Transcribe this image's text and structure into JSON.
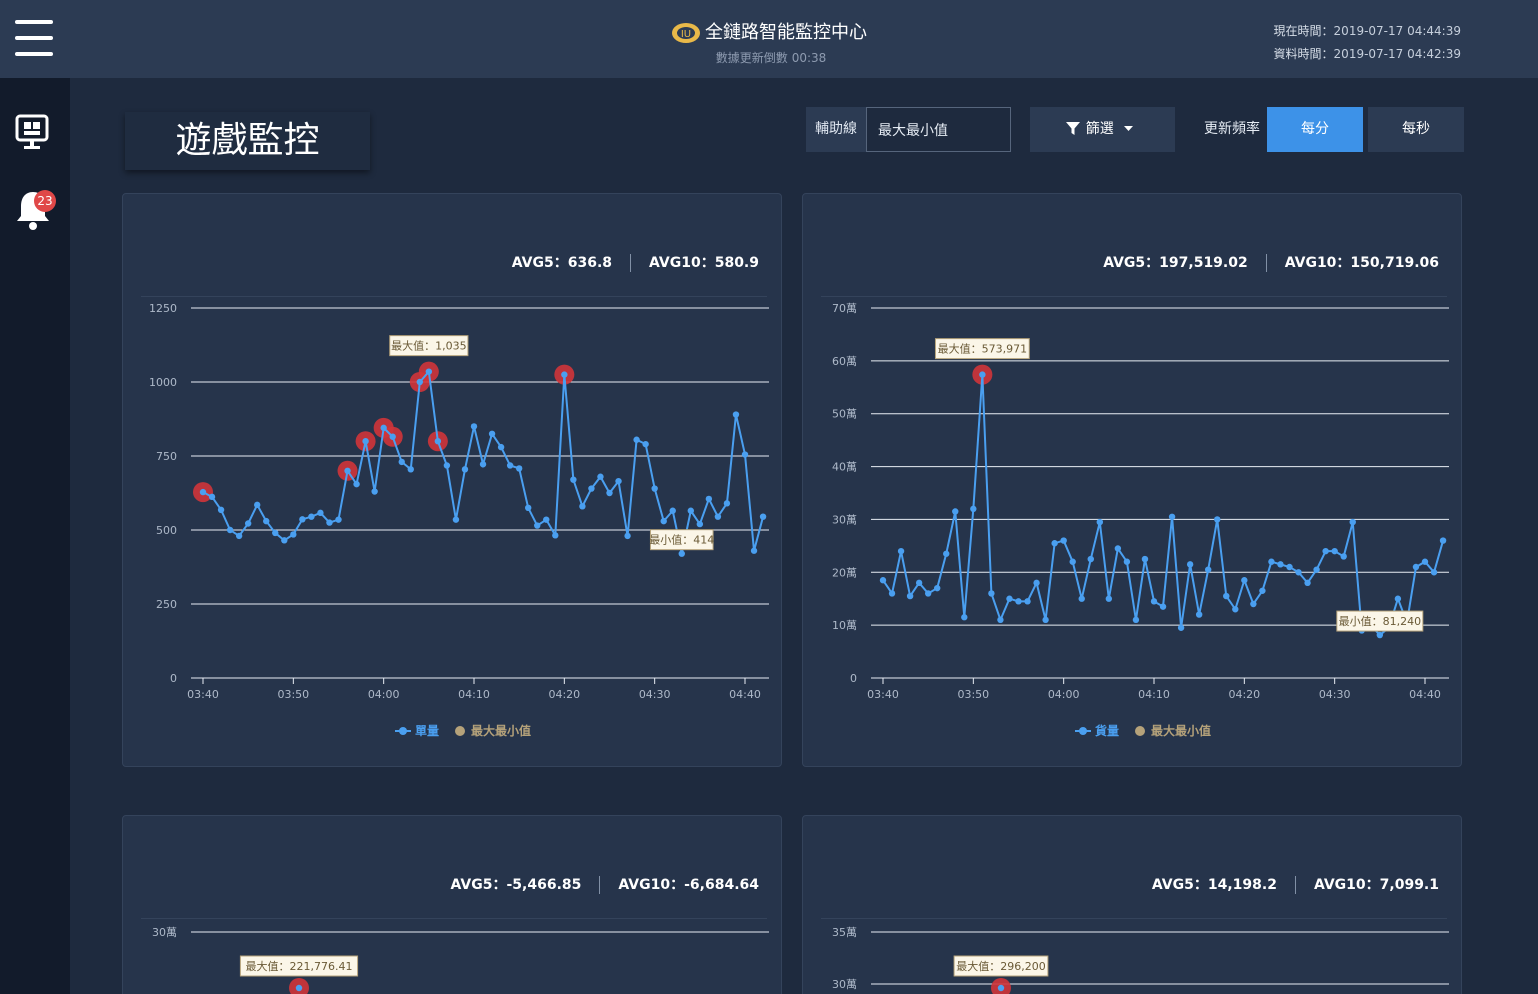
{
  "header": {
    "brand_title": "全鏈路智能監控中心",
    "countdown_label": "數據更新倒數",
    "countdown_value": "00:38",
    "now_label": "現在時間：",
    "now_value": "2019-07-17 04:44:39",
    "data_label": "資料時間：",
    "data_value": "2019-07-17 04:42:39"
  },
  "sidebar": {
    "icons": [
      "monitor-icon",
      "bell-icon"
    ],
    "notification_count": "23"
  },
  "page": {
    "title": "遊戲監控"
  },
  "controls": {
    "aux_label": "輔助線",
    "aux_value": "最大最小值",
    "filter_label": "篩選",
    "freq_label": "更新頻率",
    "freq_options": [
      "每分",
      "每秒"
    ],
    "freq_selected": "每分"
  },
  "colors": {
    "line": "#4a9ff0",
    "marker": "#d0343a",
    "legend_minmax": "#b5a27a",
    "active": "#3d92e8"
  },
  "panels": [
    {
      "avg5": "AVG5：636.8",
      "avg10": "AVG10：580.9"
    },
    {
      "avg5": "AVG5：197,519.02",
      "avg10": "AVG10：150,719.06"
    },
    {
      "avg5": "AVG5：-5,466.85",
      "avg10": "AVG10：-6,684.64"
    },
    {
      "avg5": "AVG5：14,198.2",
      "avg10": "AVG10：7,099.1"
    }
  ],
  "chart_data": [
    {
      "type": "line",
      "yticks": [
        "0",
        "250",
        "500",
        "750",
        "1000",
        "1250"
      ],
      "ylim": [
        0,
        1250
      ],
      "xticks": [
        "03:40",
        "03:50",
        "04:00",
        "04:10",
        "04:20",
        "04:30",
        "04:40"
      ],
      "x_start": "03:40",
      "x_end": "04:42",
      "series": [
        {
          "name": "單量",
          "values": [
            628,
            612,
            568,
            500,
            480,
            522,
            585,
            530,
            490,
            465,
            485,
            536,
            545,
            558,
            525,
            535,
            700,
            655,
            800,
            630,
            845,
            815,
            730,
            705,
            1000,
            1035,
            800,
            718,
            535,
            705,
            850,
            722,
            825,
            780,
            718,
            708,
            575,
            515,
            535,
            482,
            1025,
            670,
            580,
            640,
            680,
            625,
            665,
            480,
            805,
            790,
            640,
            530,
            565,
            420,
            565,
            520,
            605,
            545,
            590,
            890,
            755,
            430,
            545
          ]
        }
      ],
      "max_label": "最大值：1,035",
      "min_label": "最小值：414",
      "highlight_indices": [
        0,
        16,
        18,
        20,
        21,
        24,
        25,
        26,
        40
      ],
      "legend": [
        {
          "label": "單量"
        },
        {
          "label": "最大最小值"
        }
      ],
      "grid": true
    },
    {
      "type": "line",
      "yticks": [
        "0",
        "10萬",
        "20萬",
        "30萬",
        "40萬",
        "50萬",
        "60萬",
        "70萬"
      ],
      "ylim": [
        0,
        700000
      ],
      "xticks": [
        "03:40",
        "03:50",
        "04:00",
        "04:10",
        "04:20",
        "04:30",
        "04:40"
      ],
      "x_start": "03:40",
      "x_end": "04:42",
      "series": [
        {
          "name": "貨量",
          "values": [
            185000,
            160000,
            240000,
            155000,
            180000,
            160000,
            170000,
            235000,
            315000,
            115000,
            320000,
            573971,
            160000,
            110000,
            150000,
            145000,
            145000,
            180000,
            110000,
            255000,
            260000,
            220000,
            150000,
            225000,
            295000,
            150000,
            245000,
            220000,
            110000,
            225000,
            145000,
            135000,
            305000,
            95000,
            215000,
            120000,
            205000,
            300000,
            155000,
            130000,
            185000,
            140000,
            165000,
            220000,
            215000,
            210000,
            200000,
            180000,
            205000,
            240000,
            240000,
            230000,
            295000,
            90000,
            100000,
            81240,
            95000,
            150000,
            105000,
            210000,
            220000,
            200000,
            260000
          ]
        }
      ],
      "max_label": "最大值：573,971",
      "min_label": "最小值：81,240",
      "highlight_indices": [
        11
      ],
      "legend": [
        {
          "label": "貨量"
        },
        {
          "label": "最大最小值"
        }
      ],
      "grid": true
    },
    {
      "type": "line",
      "yticks": [
        "30萬"
      ],
      "max_label": "最大值：221,776.41",
      "grid": true
    },
    {
      "type": "line",
      "yticks": [
        "35萬",
        "30萬"
      ],
      "max_label": "最大值：296,200",
      "grid": true
    }
  ]
}
